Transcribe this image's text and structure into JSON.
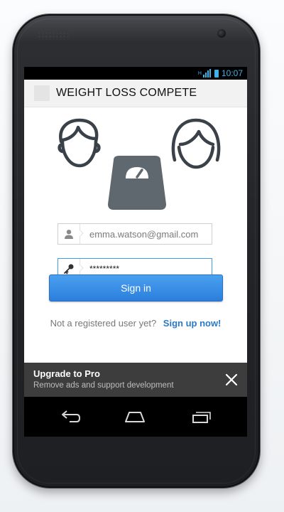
{
  "status": {
    "time": "10:07",
    "network": "H"
  },
  "actionbar": {
    "title": "WEIGHT LOSS COMPETE"
  },
  "login": {
    "email_value": "emma.watson@gmail.com",
    "password_value": "*********",
    "signin_label": "Sign in",
    "not_registered": "Not a registered user yet?",
    "signup_link": "Sign up now!"
  },
  "banner": {
    "title": "Upgrade to Pro",
    "subtitle": "Remove ads and support development"
  },
  "icons": [
    "male-face-icon",
    "female-face-icon",
    "scale-icon",
    "user-icon",
    "key-icon",
    "close-icon",
    "back-icon",
    "home-icon",
    "recent-apps-icon"
  ],
  "colors": {
    "accent": "#3f9be8",
    "button": "#2b7fdc",
    "link": "#2a79c7",
    "banner": "#3d3d3d"
  }
}
